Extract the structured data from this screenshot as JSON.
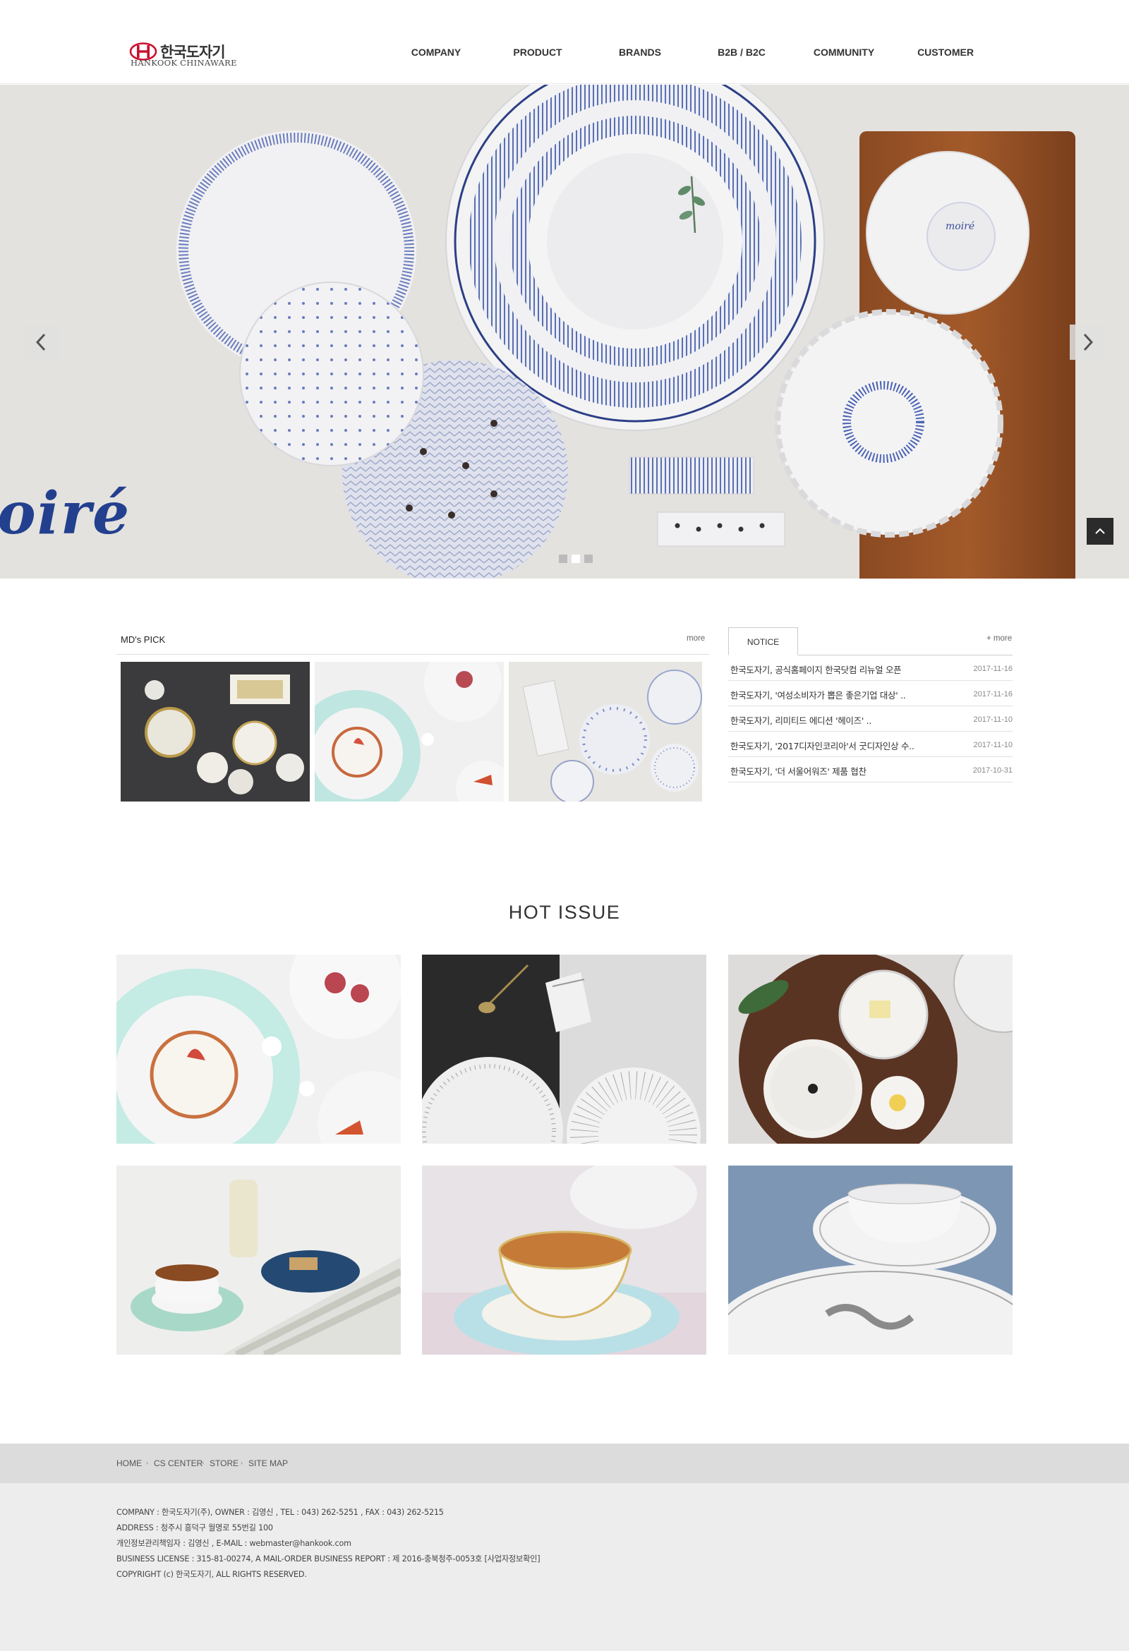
{
  "header": {
    "logo_korean": "한국도자기",
    "logo_english": "HANKOOK CHINAWARE",
    "nav": [
      "COMPANY",
      "PRODUCT",
      "BRANDS",
      "B2B / B2C",
      "COMMUNITY",
      "CUSTOMER"
    ]
  },
  "hero": {
    "brand_text": "oiré",
    "slide_count": 3,
    "active_slide": 2
  },
  "mds_pick": {
    "title": "MD's PICK",
    "more": "more"
  },
  "notice": {
    "tab": "NOTICE",
    "more": "+ more",
    "items": [
      {
        "title": "한국도자기, 공식홈페이지 한국닷컴 리뉴얼 오픈",
        "date": "2017-11-16"
      },
      {
        "title": "한국도자기, '여성소비자가 뽑은 좋은기업 대상' ..",
        "date": "2017-11-16"
      },
      {
        "title": "한국도자기, 리미티드 에디션 '헤이즈' ..",
        "date": "2017-11-10"
      },
      {
        "title": "한국도자기, '2017디자인코리아'서 굿디자인상 수..",
        "date": "2017-11-10"
      },
      {
        "title": "한국도자기, '더 서울어워즈' 제품 협찬",
        "date": "2017-10-31"
      }
    ]
  },
  "hot_issue": {
    "title": "HOT ISSUE"
  },
  "footer_nav": [
    "HOME",
    "CS CENTER",
    "STORE",
    "SITE MAP"
  ],
  "footer": {
    "lines": [
      "COMPANY : 한국도자기(주), OWNER : 김영신 , TEL : 043) 262-5251 , FAX : 043) 262-5215",
      "ADDRESS : 청주시 흥덕구 월명로 55번길 100",
      "개인정보관리책임자 : 김영신 , E-MAIL : webmaster@hankook.com",
      "BUSINESS LICENSE : 315-81-00274, A MAIL-ORDER BUSINESS REPORT : 제 2016-충북청주-0053호 [사업자정보확인]",
      "COPYRIGHT (c) 한국도자기, ALL RIGHTS RESERVED."
    ]
  },
  "colors": {
    "brand_red": "#c8102e",
    "moire_blue": "#23408f",
    "footer_nav_bg": "#dcdcdc",
    "footer_bg": "#ededed"
  }
}
